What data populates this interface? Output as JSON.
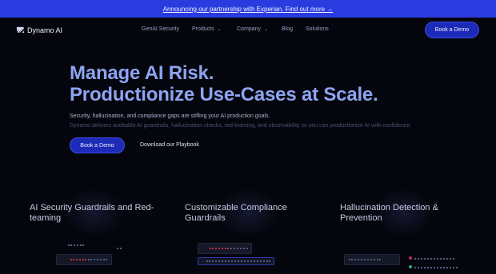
{
  "announcement": {
    "text": "Announcing our partnership with Experian. Find out more →"
  },
  "nav": {
    "logo_text": "Dynamo AI",
    "links": [
      {
        "label": "GenAI Security"
      },
      {
        "label": "Products",
        "chevron": "chevron-down-icon"
      },
      {
        "label": "Company",
        "chevron": "chevron-down-icon"
      },
      {
        "label": "Blog"
      },
      {
        "label": "Solutions"
      }
    ],
    "cta": "Book a Demo"
  },
  "hero": {
    "title_line1": "Manage AI Risk.",
    "title_line2": "Productionize Use-Cases at Scale.",
    "subtitle": "Security, hallucination, and compliance gaps are stifling your AI production goals.",
    "description": "Dynamo delivers auditable AI guardrails, hallucination checks, red-teaming, and observability so you can productionize AI with confidence.",
    "primary_button": "Book a Demo",
    "secondary_button": "Download our Playbook"
  },
  "features": [
    {
      "title": "AI Security Guardrails and Red-teaming"
    },
    {
      "title": "Customizable Compliance Guardrails"
    },
    {
      "title": "Hallucination Detection & Prevention"
    }
  ],
  "colors": {
    "accent": "#2a3be0",
    "background": "#05060d",
    "title": "#8ea4f2"
  }
}
